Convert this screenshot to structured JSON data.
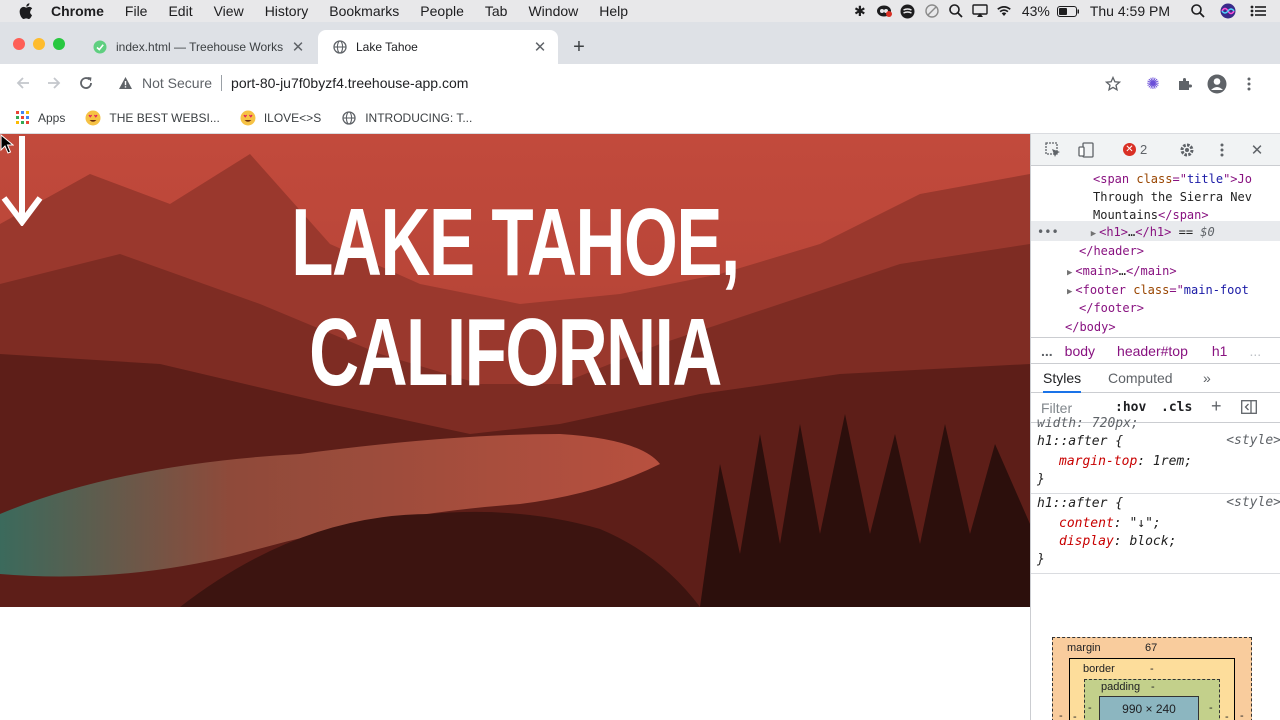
{
  "menubar": {
    "app_name": "Chrome",
    "items": [
      "File",
      "Edit",
      "View",
      "History",
      "Bookmarks",
      "People",
      "Tab",
      "Window",
      "Help"
    ],
    "battery": "43%",
    "clock": "Thu 4:59 PM"
  },
  "tabs": [
    {
      "title": "index.html — Treehouse Works",
      "active": false
    },
    {
      "title": "Lake Tahoe",
      "active": true
    }
  ],
  "toolbar": {
    "security_label": "Not Secure",
    "url": "port-80-ju7f0byzf4.treehouse-app.com"
  },
  "bookmarks": [
    {
      "label": "Apps",
      "icon": "apps-grid-icon"
    },
    {
      "label": "THE BEST WEBSI...",
      "icon": "heart-eyes-emoji-icon"
    },
    {
      "label": "ILOVE<>S",
      "icon": "heart-eyes-emoji-icon"
    },
    {
      "label": "INTRODUCING: T...",
      "icon": "globe-icon"
    }
  ],
  "page": {
    "hero_title": "LAKE TAHOE, CALIFORNIA",
    "hero_arrow": "↓"
  },
  "devtools": {
    "error_count": "2",
    "dom": {
      "line1_tag": "<span ",
      "line1_attr": "class",
      "line1_eq": "=\"",
      "line1_val": "title",
      "line1_rest": "\">Jo",
      "line2": "Through the Sierra Nev",
      "line3_text": "Mountains",
      "line3_close": "</span>",
      "line4_open": "<h1>",
      "line4_ellipsis": "…",
      "line4_close": "</h1>",
      "line4_eq": " == ",
      "line4_dollar": "$0",
      "line5": "</header>",
      "line6_open": "<main>",
      "line6_ellipsis": "…",
      "line6_close": "</main>",
      "line7_tag": "<footer ",
      "line7_attr": "class",
      "line7_eq": "=\"",
      "line7_val": "main-foot",
      "line8": "</footer>",
      "line9": "</body>"
    },
    "breadcrumbs": {
      "dots": "...",
      "body": "body",
      "header": "header#top",
      "h1": "h1",
      "more": "..."
    },
    "subtabs": {
      "styles": "Styles",
      "computed": "Computed",
      "more": "»"
    },
    "filter": {
      "placeholder": "Filter",
      "hov": ":hov",
      "cls": ".cls",
      "add": "+"
    },
    "rules": {
      "clipped": "width: 720px;",
      "r1_selector": "h1::after {",
      "r1_source": "<style>",
      "r1_prop": "margin-top",
      "r1_value": " 1rem;",
      "r1_close": "}",
      "r2_selector": "h1::after {",
      "r2_source": "<style>",
      "r2_prop1": "content",
      "r2_value1": " \"↓\";",
      "r2_prop2": "display",
      "r2_value2": " block;",
      "r2_close": "}"
    },
    "boxmodel": {
      "margin_label": "margin",
      "margin_value": "67",
      "border_label": "border",
      "border_value": "-",
      "padding_label": "padding",
      "padding_value": "-",
      "content_size": "990 × 240",
      "side_dash": "-"
    }
  },
  "colors": {
    "hero_tint": "#b8473a",
    "chrome_tabstrip": "#dee1e6",
    "link_blue": "#1a73e8"
  }
}
